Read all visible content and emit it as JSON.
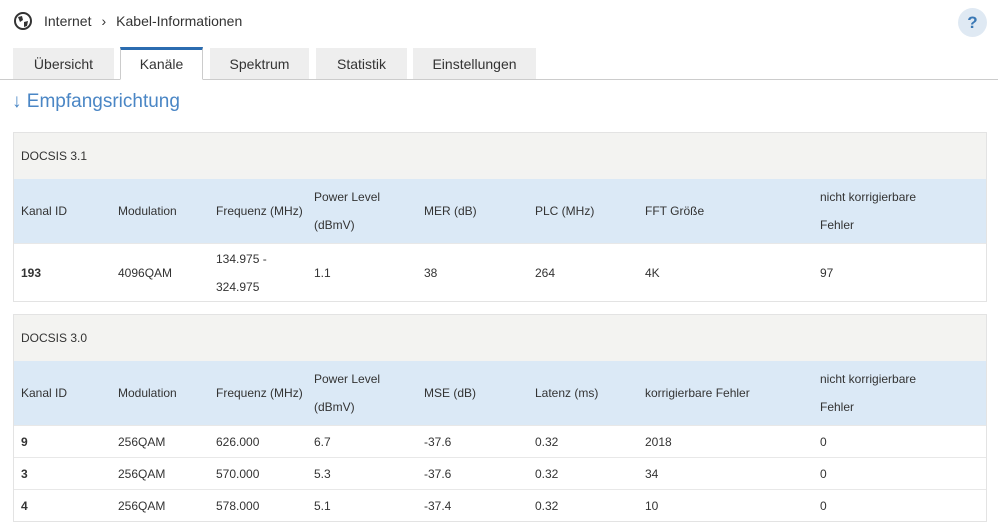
{
  "breadcrumb": {
    "root": "Internet",
    "current": "Kabel-Informationen"
  },
  "help_label": "?",
  "tabs": [
    "Übersicht",
    "Kanäle",
    "Spektrum",
    "Statistik",
    "Einstellungen"
  ],
  "heading": "↓ Empfangsrichtung",
  "docsis31": {
    "title": "DOCSIS 3.1",
    "columns": [
      "Kanal ID",
      "Modulation",
      "Frequenz (MHz)",
      "Power Level (dBmV)",
      "MER (dB)",
      "PLC (MHz)",
      "FFT Größe",
      "nicht korrigierbare Fehler"
    ],
    "rows": [
      [
        "193",
        "4096QAM",
        "134.975 - 324.975",
        "1.1",
        "38",
        "264",
        "4K",
        "97"
      ]
    ]
  },
  "docsis30": {
    "title": "DOCSIS 3.0",
    "columns": [
      "Kanal ID",
      "Modulation",
      "Frequenz (MHz)",
      "Power Level (dBmV)",
      "MSE (dB)",
      "Latenz (ms)",
      "korrigierbare Fehler",
      "nicht korrigierbare Fehler"
    ],
    "rows": [
      [
        "9",
        "256QAM",
        "626.000",
        "6.7",
        "-37.6",
        "0.32",
        "2018",
        "0"
      ],
      [
        "3",
        "256QAM",
        "570.000",
        "5.3",
        "-37.6",
        "0.32",
        "34",
        "0"
      ],
      [
        "4",
        "256QAM",
        "578.000",
        "5.1",
        "-37.4",
        "0.32",
        "10",
        "0"
      ]
    ]
  }
}
